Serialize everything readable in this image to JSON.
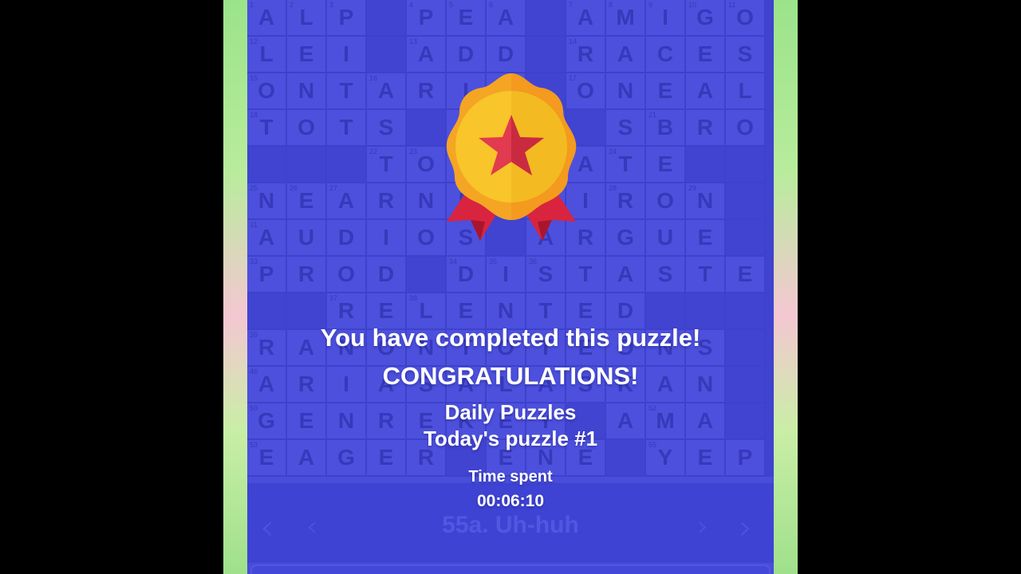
{
  "colors": {
    "panel": "#4b4fd9",
    "cell": "#5054de",
    "block": "#3f41c9",
    "letter": "#2e30a8",
    "text": "#ffffff"
  },
  "grid": {
    "rows": [
      "ALP#PEA#AMIGO",
      "LEI#ADD#RACES",
      "ONTARIO#ONEAL",
      "TOTS#RAN#SBRO",
      "###TORMEATE##",
      "NEARNE#GIRON#",
      "AUDIOS#ARGUE#",
      "PROD#DISTASTE",
      "##RELENTED###",
      "RANONTOTEONS#",
      "ARIASALASKAN#",
      "GENREKEY#AMA#",
      "EAGER#ENE#YEP"
    ],
    "numbers": {
      "0,0": "1",
      "0,1": "2",
      "0,2": "3",
      "0,4": "4",
      "0,5": "5",
      "0,6": "6",
      "0,8": "7",
      "0,9": "8",
      "0,10": "9",
      "0,11": "10",
      "0,12": "11",
      "1,0": "12",
      "1,4": "13",
      "1,8": "14",
      "2,0": "15",
      "2,3": "16",
      "2,8": "17",
      "3,0": "18",
      "3,10": "21",
      "4,3": "22",
      "4,4": "23",
      "4,9": "24",
      "5,0": "25",
      "5,1": "26",
      "5,2": "27",
      "5,9": "28",
      "5,11": "29",
      "5,12": "30",
      "6,0": "31",
      "7,0": "33",
      "7,5": "34",
      "7,6": "35",
      "7,7": "36",
      "8,2": "37",
      "8,4": "38",
      "9,0": "39",
      "9,12": "45",
      "10,0": "46",
      "11,0": "50",
      "11,10": "52",
      "12,0": "53",
      "12,10": "55"
    }
  },
  "dialog": {
    "completed": "You have completed this puzzle!",
    "congrats": "CONGRATULATIONS!",
    "mode": "Daily Puzzles",
    "puzzle": "Today's puzzle #1",
    "time_label": "Time spent",
    "time_value": "00:06:10"
  },
  "clue_bar": {
    "clue": "55a. Uh-huh",
    "icons": [
      "prev-word-icon",
      "prev-letter-icon",
      "next-letter-icon",
      "next-word-icon"
    ]
  }
}
